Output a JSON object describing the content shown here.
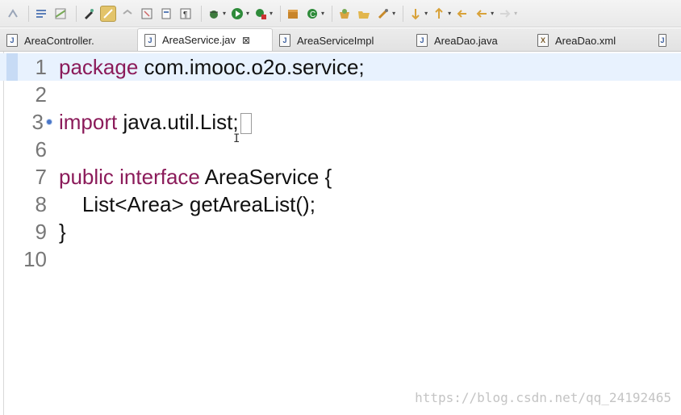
{
  "toolbar": {
    "icons": [
      "bookmark-icon",
      "toggle-mark-icon",
      "highlight-icon",
      "pen-icon",
      "breadcrumb-icon",
      "block-icon",
      "paragraph-icon",
      "debug-icon",
      "run-icon",
      "external-tools-icon",
      "new-package-icon",
      "new-class-icon",
      "open-type-icon",
      "open-folder-icon",
      "open-task-icon",
      "next-annotation-icon",
      "prev-annotation-icon",
      "back-icon",
      "forward-icon"
    ]
  },
  "tabs": [
    {
      "label": "AreaController.",
      "icon": "J"
    },
    {
      "label": "AreaService.jav",
      "icon": "J",
      "active": true
    },
    {
      "label": "AreaServiceImpl",
      "icon": "J"
    },
    {
      "label": "AreaDao.java",
      "icon": "J"
    },
    {
      "label": "AreaDao.xml",
      "icon": "X"
    },
    {
      "label": "",
      "icon": "J"
    }
  ],
  "editor": {
    "lines": [
      {
        "num": "1",
        "kw": "package",
        "rest": " com.imooc.o2o.service;"
      },
      {
        "num": "2",
        "kw": "",
        "rest": ""
      },
      {
        "num": "3",
        "kw": "import",
        "rest": " java.util.List;"
      },
      {
        "num": "6",
        "kw": "",
        "rest": ""
      },
      {
        "num": "7",
        "kw": "public interface",
        "rest": " AreaService {"
      },
      {
        "num": "8",
        "kw": "",
        "rest": "    List<Area> getAreaList();"
      },
      {
        "num": "9",
        "kw": "",
        "rest": "}"
      },
      {
        "num": "10",
        "kw": "",
        "rest": ""
      }
    ]
  },
  "watermark": "https://blog.csdn.net/qq_24192465",
  "colors": {
    "keyword": "#8b1b5a",
    "line_highlight": "#e8f2fe"
  }
}
